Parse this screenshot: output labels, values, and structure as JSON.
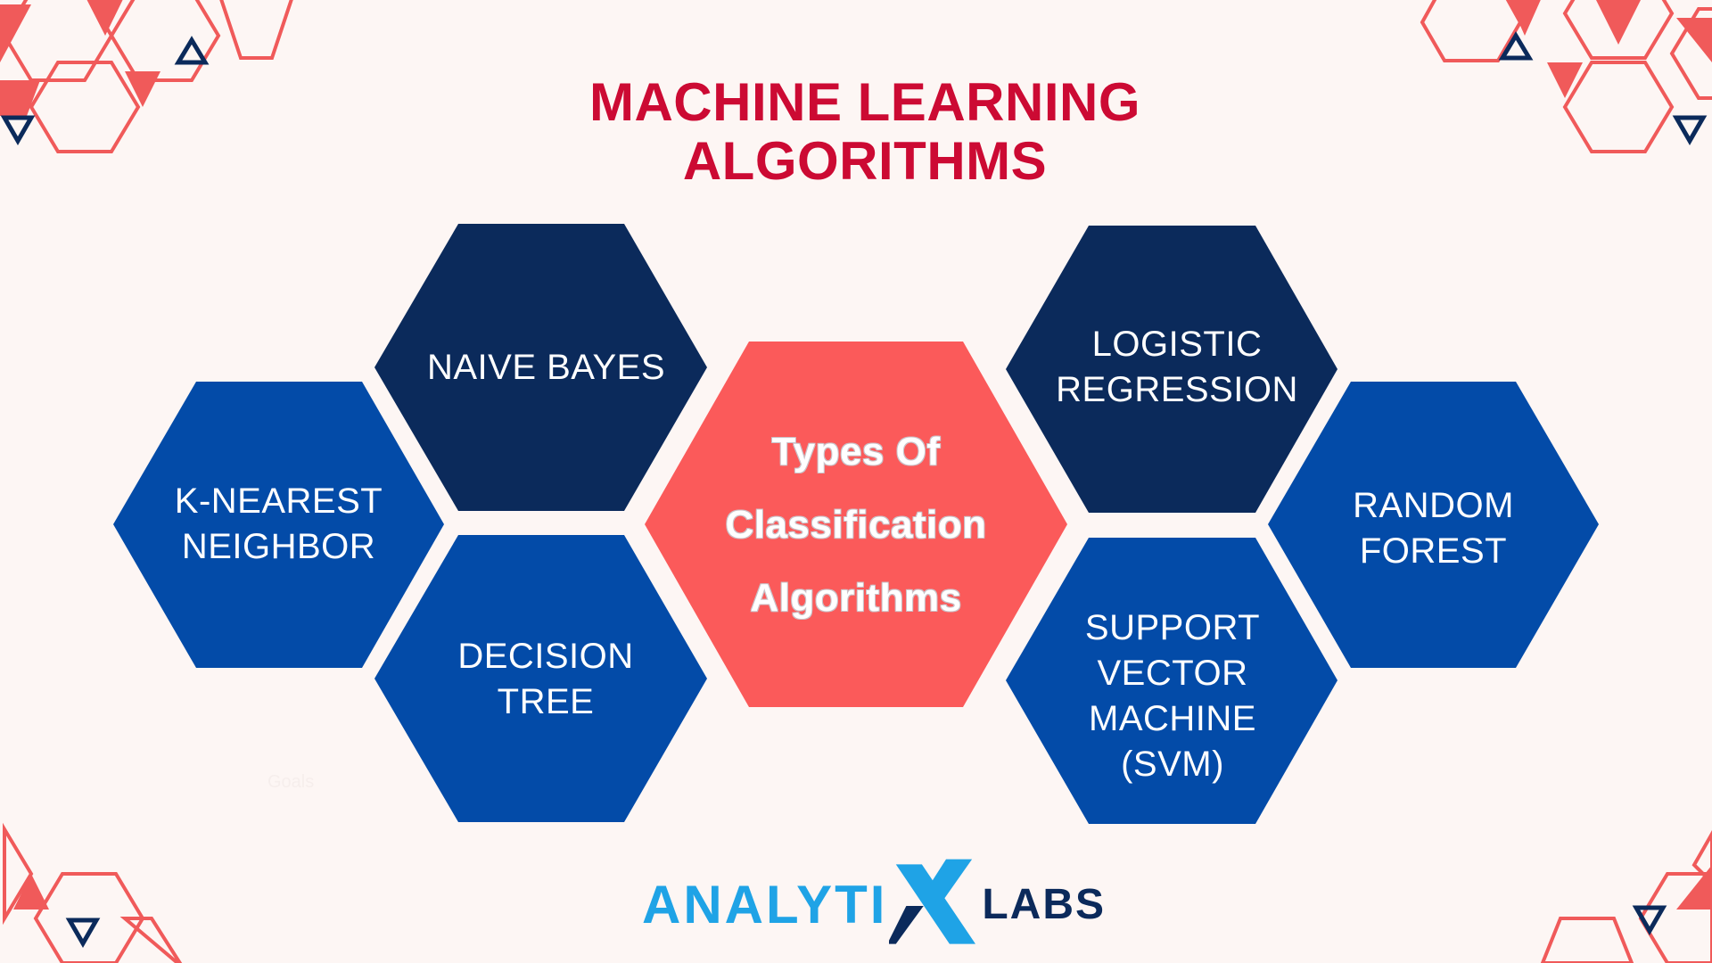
{
  "title": "MACHINE LEARNING\nALGORITHMS",
  "center": {
    "label": "Types Of\nClassification\nAlgorithms"
  },
  "nodes": [
    {
      "id": "naive-bayes",
      "label": "NAIVE BAYES"
    },
    {
      "id": "k-nearest-neighbor",
      "label": "K-NEAREST\nNEIGHBOR"
    },
    {
      "id": "decision-tree",
      "label": "DECISION TREE"
    },
    {
      "id": "logistic-regression",
      "label": "LOGISTIC\nREGRESSION"
    },
    {
      "id": "random-forest",
      "label": "RANDOM\nFOREST"
    },
    {
      "id": "svm",
      "label": "SUPPORT\nVECTOR\nMACHINE\n(SVM)"
    }
  ],
  "faint_text": "Goals",
  "logo": {
    "part1": "ANALYTI",
    "part2": "LABS"
  },
  "colors": {
    "title": "#cc0a33",
    "center_fill": "#fb5a5a",
    "dark_navy": "#0b2a5b",
    "royal_blue": "#034ba8",
    "deco_red": "#f05a5a",
    "logo_blue": "#1fa3e6"
  }
}
